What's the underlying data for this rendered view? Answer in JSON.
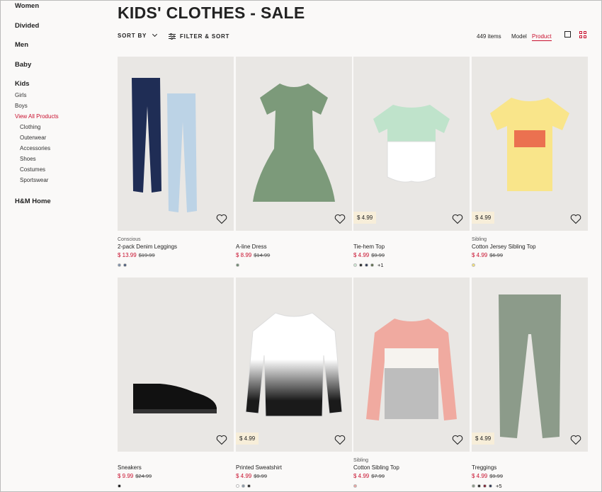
{
  "sidebar": {
    "top_items": [
      {
        "label": "Women"
      },
      {
        "label": "Divided"
      },
      {
        "label": "Men"
      },
      {
        "label": "Baby"
      },
      {
        "label": "Kids"
      }
    ],
    "kids_items": [
      {
        "label": "Girls"
      },
      {
        "label": "Boys"
      },
      {
        "label": "View All Products"
      }
    ],
    "sub_items": [
      {
        "label": "Clothing"
      },
      {
        "label": "Outerwear"
      },
      {
        "label": "Accessories"
      },
      {
        "label": "Shoes"
      },
      {
        "label": "Costumes"
      },
      {
        "label": "Sportswear"
      }
    ],
    "home": "H&M Home"
  },
  "header": {
    "title": "KIDS' CLOTHES - SALE",
    "sort_by": "SORT BY",
    "filter_sort": "FILTER & SORT",
    "items_count": "449 items",
    "view_model": "Model",
    "view_product": "Product"
  },
  "colors": {
    "accent": "#c8102e",
    "price_tag_bg": "#f7eed9"
  },
  "products": [
    {
      "label": "Conscious",
      "name": "2-pack Denim Leggings",
      "sale": "$ 13.99",
      "orig": "$19.99",
      "tag": "",
      "swatches": [
        "#7d8fa8",
        "#4a5a7a"
      ],
      "more": ""
    },
    {
      "label": "",
      "name": "A-line Dress",
      "sale": "$ 8.99",
      "orig": "$14.99",
      "tag": "",
      "swatches": [
        "#6e8a70"
      ],
      "more": ""
    },
    {
      "label": "",
      "name": "Tie-hem Top",
      "sale": "$ 4.99",
      "orig": "$9.99",
      "tag": "$ 4.99",
      "swatches": [
        "#cfe8d4",
        "#222222",
        "#2b3550",
        "#5b6b4a"
      ],
      "more": "+1"
    },
    {
      "label": "Sibling",
      "name": "Cotton Jersey Sibling Top",
      "sale": "$ 4.99",
      "orig": "$6.99",
      "tag": "$ 4.99",
      "swatches": [
        "#f5e27a"
      ],
      "more": ""
    },
    {
      "label": "",
      "name": "Sneakers",
      "sale": "$ 9.99",
      "orig": "$24.99",
      "tag": "",
      "swatches": [
        "#111111"
      ],
      "more": ""
    },
    {
      "label": "",
      "name": "Printed Sweatshirt",
      "sale": "$ 4.99",
      "orig": "$9.99",
      "tag": "$ 4.99",
      "swatches": [
        "#ffffff",
        "#8a9aaa",
        "#222222"
      ],
      "more": ""
    },
    {
      "label": "Sibling",
      "name": "Cotton Sibling Top",
      "sale": "$ 4.99",
      "orig": "$7.99",
      "tag": "",
      "swatches": [
        "#e8a3a0"
      ],
      "more": ""
    },
    {
      "label": "",
      "name": "Treggings",
      "sale": "$ 4.99",
      "orig": "$9.99",
      "tag": "$ 4.99",
      "swatches": [
        "#8a9a88",
        "#222222",
        "#7a1a2a",
        "#2b3550"
      ],
      "more": "+5"
    }
  ]
}
